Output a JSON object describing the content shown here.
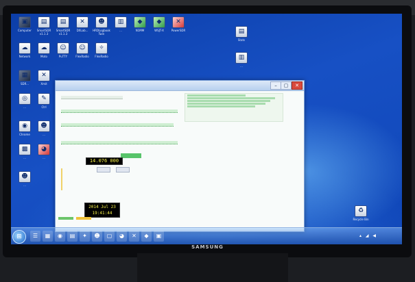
{
  "monitor": {
    "brand": "SAMSUNG"
  },
  "desktop": {
    "icons": [
      {
        "id": "computer",
        "label": "Computer",
        "icon": "computer-icon",
        "style": "dark",
        "glyph": "▣"
      },
      {
        "id": "smartsdr",
        "label": "SmartSDR\nv1.1.3",
        "icon": "app-icon",
        "style": "doc",
        "glyph": "▤"
      },
      {
        "id": "smartsdr2",
        "label": "SmartSDR\nv1.1.3",
        "icon": "app-icon",
        "style": "doc",
        "glyph": "▤"
      },
      {
        "id": "dxlab",
        "label": "DXLab...",
        "icon": "app-icon",
        "style": "doc",
        "glyph": "✕"
      },
      {
        "id": "hrd",
        "label": "HRDLogbook\nTwin",
        "icon": "app-icon",
        "style": "doc",
        "glyph": "☻"
      },
      {
        "id": "app6",
        "label": "...",
        "icon": "app-icon",
        "style": "doc",
        "glyph": "▥"
      },
      {
        "id": "app7",
        "label": "N1MM",
        "icon": "app-icon",
        "style": "green",
        "glyph": "◆"
      },
      {
        "id": "app8",
        "label": "WSJT-X",
        "icon": "app-icon",
        "style": "green",
        "glyph": "◆"
      },
      {
        "id": "app9",
        "label": "PowerSDR",
        "icon": "app-icon",
        "style": "red",
        "glyph": "✕"
      },
      {
        "id": "network",
        "label": "Network",
        "icon": "network-icon",
        "style": "doc",
        "glyph": "☁"
      },
      {
        "id": "app11",
        "label": "Moto",
        "icon": "app-icon",
        "style": "doc",
        "glyph": "☁"
      },
      {
        "id": "app12",
        "label": "PuTTY",
        "icon": "app-icon",
        "style": "doc",
        "glyph": "☺"
      },
      {
        "id": "app13",
        "label": "FlexRadio",
        "icon": "app-icon",
        "style": "doc",
        "glyph": "☺"
      },
      {
        "id": "app14",
        "label": "FlexRadio",
        "icon": "app-icon",
        "style": "doc",
        "glyph": "✧"
      },
      {
        "id": "app15",
        "label": "SDR...",
        "icon": "app-icon",
        "style": "dark",
        "glyph": "▦"
      },
      {
        "id": "app16",
        "label": "Xmit",
        "icon": "app-icon",
        "style": "doc",
        "glyph": "✕"
      },
      {
        "id": "app17",
        "label": "...",
        "icon": "app-icon",
        "style": "doc",
        "glyph": "◎"
      },
      {
        "id": "app18",
        "label": "Ctrl",
        "icon": "app-icon",
        "style": "doc",
        "glyph": "✎"
      },
      {
        "id": "app19",
        "label": "Chrome",
        "icon": "app-icon",
        "style": "doc",
        "glyph": "◉"
      },
      {
        "id": "app20",
        "label": "...",
        "icon": "app-icon",
        "style": "doc",
        "glyph": "☻"
      },
      {
        "id": "app21",
        "label": "...",
        "icon": "app-icon",
        "style": "doc",
        "glyph": "▩"
      },
      {
        "id": "app22",
        "label": "...",
        "icon": "app-icon",
        "style": "red",
        "glyph": "◕"
      },
      {
        "id": "app23",
        "label": "...",
        "icon": "app-icon",
        "style": "doc",
        "glyph": "☻"
      },
      {
        "id": "file1",
        "label": "Stats",
        "icon": "file-icon",
        "style": "doc",
        "glyph": "▤"
      },
      {
        "id": "file2",
        "label": "...",
        "icon": "file-icon",
        "style": "doc",
        "glyph": "▥"
      },
      {
        "id": "recycle",
        "label": "Recycle Bin",
        "icon": "recycle-bin-icon",
        "style": "doc",
        "glyph": "♻"
      }
    ]
  },
  "app_window": {
    "frequency": "14.076 000",
    "clock_date": "2014 Jul 23",
    "clock_time": "19:41:44",
    "buttons": {
      "close": "✕",
      "maximize": "▢",
      "minimize": "–"
    }
  },
  "taskbar": {
    "start_glyph": "⊞",
    "items": [
      {
        "id": "tb1",
        "glyph": "☰"
      },
      {
        "id": "tb2",
        "glyph": "▦"
      },
      {
        "id": "tb3",
        "glyph": "◉"
      },
      {
        "id": "tb4",
        "glyph": "▤"
      },
      {
        "id": "tb5",
        "glyph": "✦"
      },
      {
        "id": "tb6",
        "glyph": "☻"
      },
      {
        "id": "tb7",
        "glyph": "▢"
      },
      {
        "id": "tb8",
        "glyph": "◕"
      },
      {
        "id": "tb9",
        "glyph": "✕"
      },
      {
        "id": "tb10",
        "glyph": "◆"
      },
      {
        "id": "tb11",
        "glyph": "▣"
      }
    ],
    "tray_glyphs": "▴ ◢ ◀",
    "colors": {
      "accent": "#1a64c8"
    }
  }
}
